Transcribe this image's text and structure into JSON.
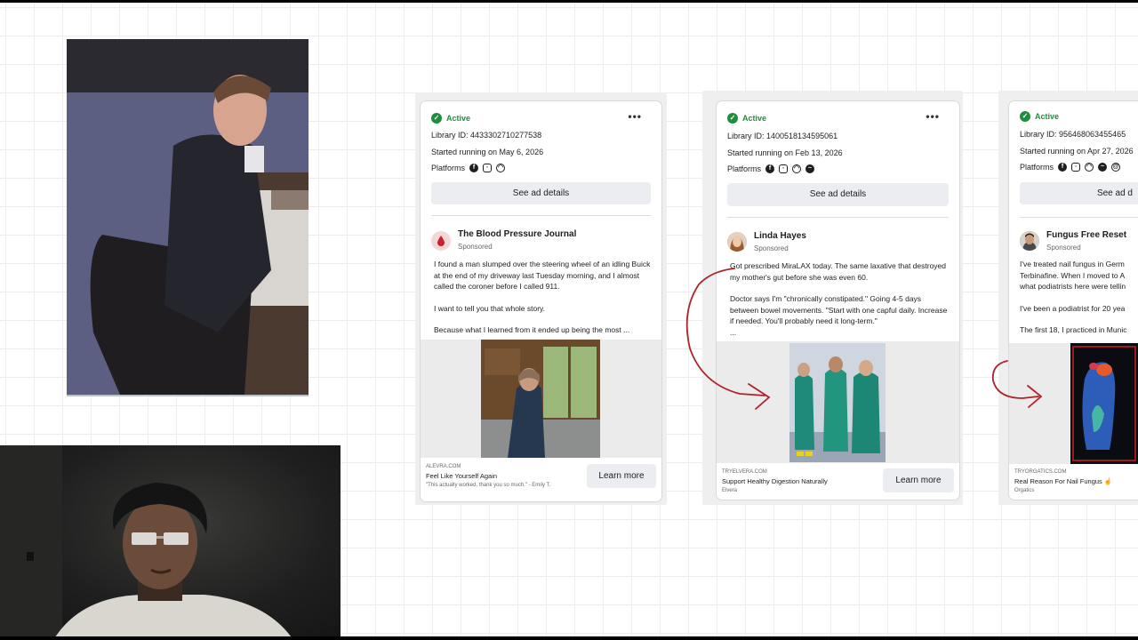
{
  "cards": [
    {
      "status": "Active",
      "library_id": "Library ID: 4433302710277538",
      "started": "Started running on May 6, 2026",
      "platforms_label": "Platforms",
      "platform_icons": [
        "facebook-icon",
        "instagram-icon",
        "audience-network-icon"
      ],
      "details_label": "See ad details",
      "advertiser": "The Blood Pressure Journal",
      "sponsored": "Sponsored",
      "body": [
        "I found a man slumped over the steering wheel of an idling Buick at the end of my driveway last Tuesday morning, and I almost called the coroner before I called 911.",
        "I want to tell you that whole story.",
        "Because what I learned from it ended up being the most ..."
      ],
      "domain": "ALEVRA.COM",
      "headline": "Feel Like Yourself Again",
      "subtext": "\"This actually worked, thank you so much.\" - Emily T.",
      "cta": "Learn more"
    },
    {
      "status": "Active",
      "library_id": "Library ID: 1400518134595061",
      "started": "Started running on Feb 13, 2026",
      "platforms_label": "Platforms",
      "platform_icons": [
        "facebook-icon",
        "instagram-icon",
        "audience-network-icon",
        "messenger-icon"
      ],
      "details_label": "See ad details",
      "advertiser": "Linda Hayes",
      "sponsored": "Sponsored",
      "body": [
        "Got prescribed MiraLAX today. The same laxative that destroyed my mother's gut before she was even 60.",
        "Doctor says I'm \"chronically constipated.\" Going 4-5 days between bowel movements. \"Start with one capful daily. Increase if needed. You'll probably need it long-term.\"",
        "..."
      ],
      "domain": "TRYELVERA.COM",
      "headline": "Support Healthy Digestion Naturally",
      "subtext": "Elvera",
      "cta": "Learn more"
    },
    {
      "status": "Active",
      "library_id": "Library ID: 956468063455465",
      "started": "Started running on Apr 27, 2026",
      "platforms_label": "Platforms",
      "platform_icons": [
        "facebook-icon",
        "instagram-icon",
        "audience-network-icon",
        "messenger-icon",
        "threads-icon"
      ],
      "details_label": "See ad d",
      "advertiser": "Fungus Free Reset",
      "sponsored": "Sponsored",
      "body": [
        "I've treated nail fungus in Germ Terbinafine. When I moved to A what podiatrists here were tellin",
        "I've been a podiatrist for 20 yea",
        "The first 18, I practiced in Munic"
      ],
      "domain": "TRYORGATICS.COM",
      "headline": "Real Reason For Nail Fungus ☝",
      "subtext": "Orgatics",
      "cta": ""
    }
  ],
  "colors": {
    "active_green": "#1e8e3e",
    "annotation_red": "#b0222a",
    "button_gray": "#ebedf0"
  }
}
